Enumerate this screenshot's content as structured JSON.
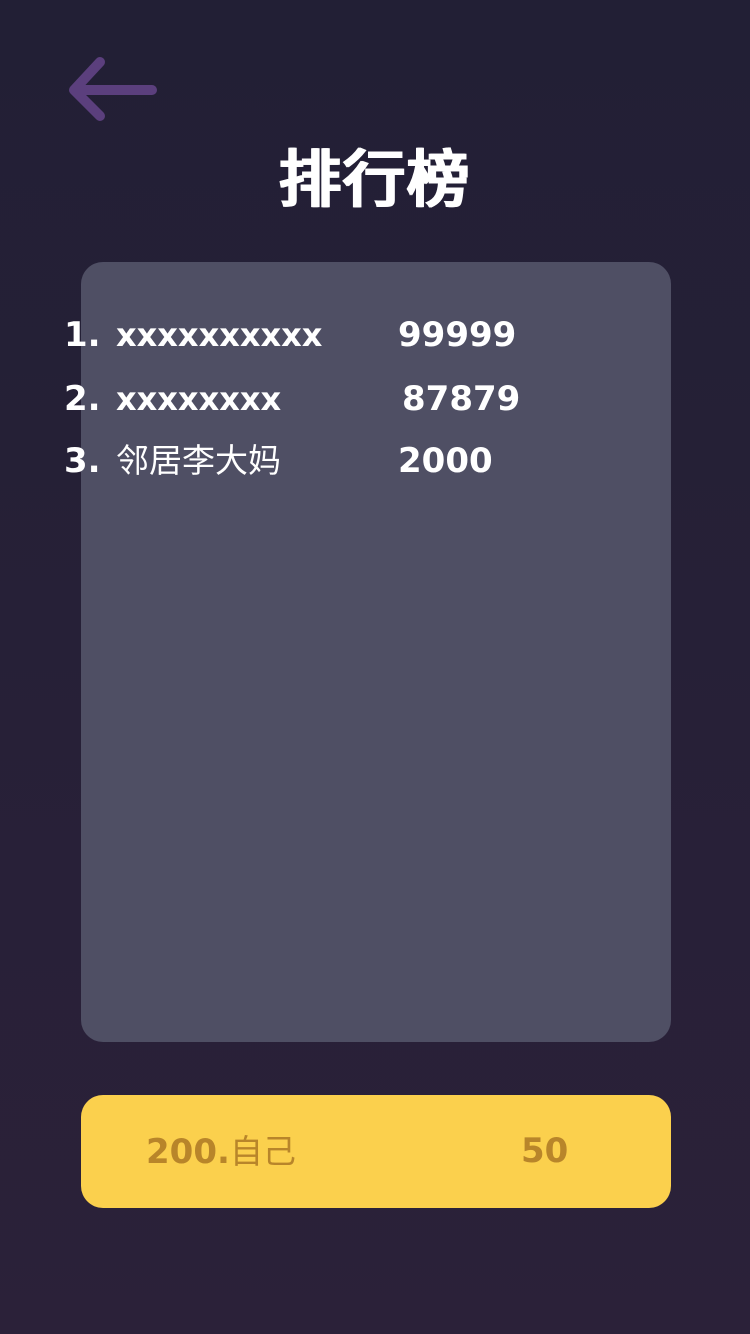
{
  "header": {
    "back_icon": "arrow-left-icon",
    "back_icon_color": "#5b3f7d",
    "title": "排行榜"
  },
  "leaderboard": {
    "entries": [
      {
        "rank": "1.",
        "name": "xxxxxxxxxx",
        "score": "99999"
      },
      {
        "rank": "2.",
        "name": "xxxxxxxx",
        "score": "87879"
      },
      {
        "rank": "3.",
        "name": "邻居李大妈",
        "score": "2000"
      }
    ],
    "panel_color": "#4f4f64"
  },
  "self_rank": {
    "position": "200.",
    "name": "自己",
    "score": "50",
    "bar_color": "#fbd04d",
    "text_color": "#b8852a"
  }
}
